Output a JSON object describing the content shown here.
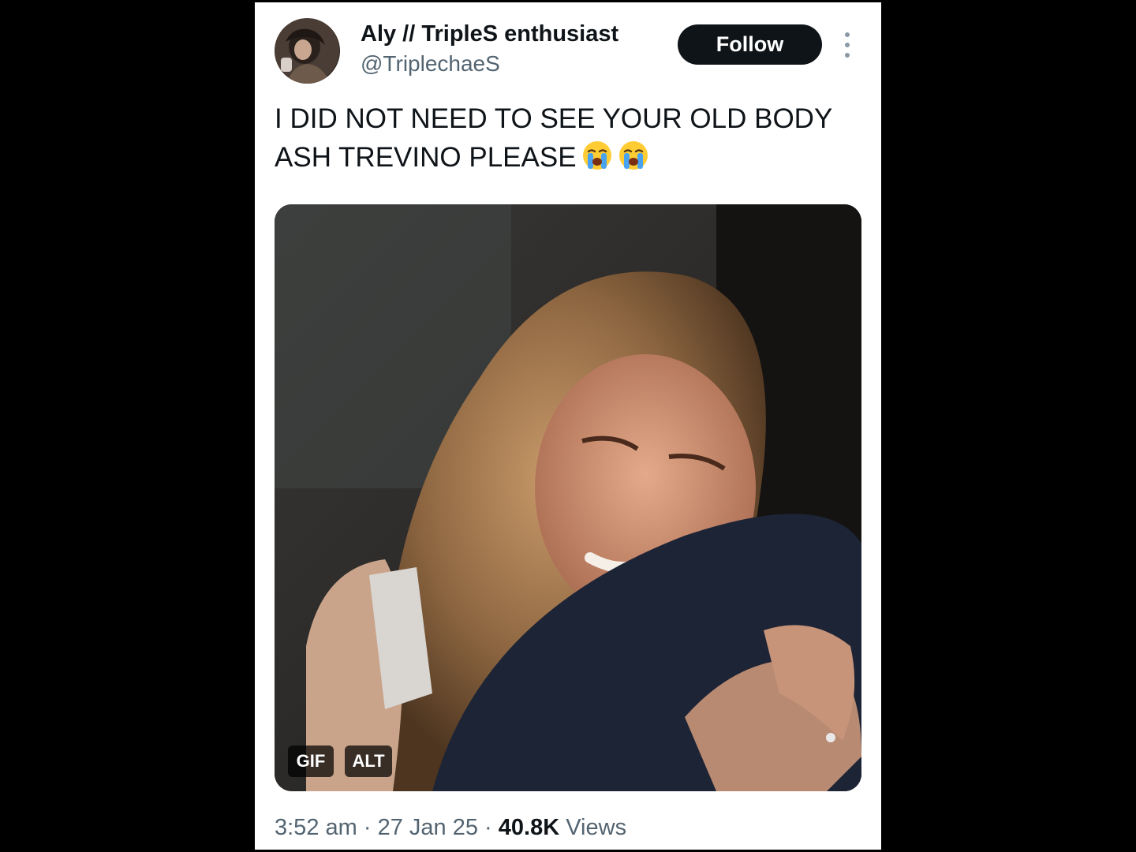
{
  "tweet": {
    "author": {
      "display_name": "Aly // TripleS enthusiast",
      "handle": "@TriplechaeS"
    },
    "follow_label": "Follow",
    "text": "I DID NOT NEED TO SEE YOUR OLD BODY ASH TREVINO PLEASE",
    "emojis": [
      "loudly-crying-face",
      "loudly-crying-face"
    ],
    "media": {
      "badges": {
        "gif": "GIF",
        "alt": "ALT"
      }
    },
    "meta": {
      "time": "3:52 am",
      "separator": "·",
      "date": "27 Jan 25",
      "views_count": "40.8K",
      "views_label": "Views"
    }
  },
  "colors": {
    "page_background": "#000000",
    "card_background": "#ffffff",
    "primary_text": "#0f1419",
    "secondary_text": "#536471",
    "follow_button": "#0f1419"
  },
  "icons": {
    "more": "more-vertical-icon",
    "emoji": "loudly-crying-face-icon"
  }
}
